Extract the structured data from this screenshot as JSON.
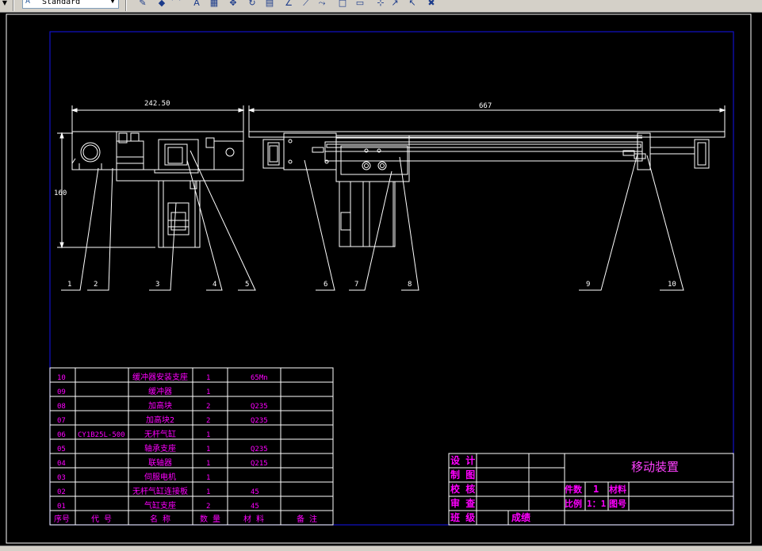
{
  "toolbar": {
    "style_combo": "Standard",
    "buttons": [
      "pencil-icon",
      "paint-bucket-icon",
      "arc-tool-icon",
      "multiline-text-icon",
      "grid-icon",
      "pan-icon",
      "rotate-icon",
      "table-icon",
      "angle-icon",
      "line-tool-icon",
      "polyline-icon",
      "rectangle-icon",
      "window-icon",
      "dimension-icon",
      "leader-icon",
      "cursor-icon",
      "eraser-icon"
    ]
  },
  "dimensions": {
    "left_width": "242.50",
    "right_width": "667",
    "left_height": "160"
  },
  "balloons": [
    "1",
    "2",
    "3",
    "4",
    "5",
    "6",
    "7",
    "8",
    "9",
    "10"
  ],
  "bom": {
    "rows": [
      {
        "no": "10",
        "code": "",
        "name": "缓冲器安装支座",
        "qty": "1",
        "material": "65Mn",
        "note": ""
      },
      {
        "no": "09",
        "code": "",
        "name": "缓冲器",
        "qty": "1",
        "material": "",
        "note": ""
      },
      {
        "no": "08",
        "code": "",
        "name": "加高块",
        "qty": "2",
        "material": "Q235",
        "note": ""
      },
      {
        "no": "07",
        "code": "",
        "name": "加高块2",
        "qty": "2",
        "material": "Q235",
        "note": ""
      },
      {
        "no": "06",
        "code": "CY1B25L-500",
        "name": "无杆气缸",
        "qty": "1",
        "material": "",
        "note": ""
      },
      {
        "no": "05",
        "code": "",
        "name": "轴承支座",
        "qty": "1",
        "material": "Q235",
        "note": ""
      },
      {
        "no": "04",
        "code": "",
        "name": "联轴器",
        "qty": "1",
        "material": "Q215",
        "note": ""
      },
      {
        "no": "03",
        "code": "",
        "name": "伺服电机",
        "qty": "1",
        "material": "",
        "note": ""
      },
      {
        "no": "02",
        "code": "",
        "name": "无杆气缸连接板",
        "qty": "1",
        "material": "45",
        "note": ""
      },
      {
        "no": "01",
        "code": "",
        "name": "气缸支座",
        "qty": "2",
        "material": "45",
        "note": ""
      }
    ],
    "headers": [
      "序号",
      "代  号",
      "名  称",
      "数 量",
      "材 料",
      "备 注"
    ]
  },
  "title_block": {
    "title": "移动装置",
    "labels": [
      "设 计",
      "制 图",
      "校 核",
      "审 查",
      "班 级"
    ],
    "class_value": "成绩",
    "count_label": "件数",
    "count_value": "1",
    "material_label": "材料",
    "scale_label": "比例",
    "scale_value": "1：1",
    "drawing_no_label": "图号"
  },
  "colors": {
    "background": "#000000",
    "frame": "#ffffff",
    "border": "#0000c8",
    "text_bom": "#ff00ff",
    "title_text": "#ff40ff"
  }
}
